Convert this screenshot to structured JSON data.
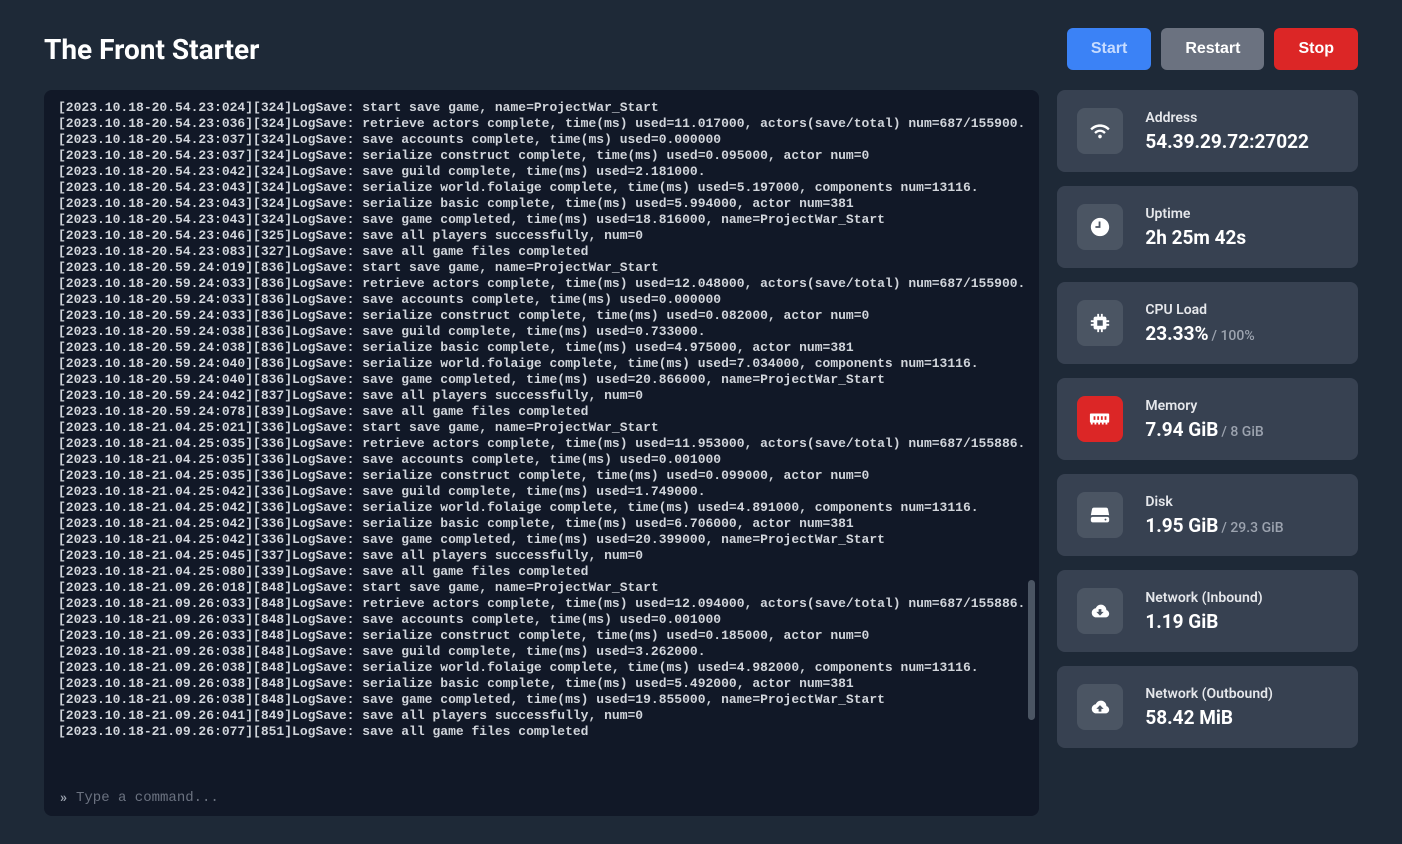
{
  "title": "The Front Starter",
  "buttons": {
    "start": "Start",
    "restart": "Restart",
    "stop": "Stop"
  },
  "command_placeholder": "Type a command...",
  "stats": {
    "address": {
      "label": "Address",
      "value": "54.39.29.72:27022"
    },
    "uptime": {
      "label": "Uptime",
      "value": "2h 25m 42s"
    },
    "cpu": {
      "label": "CPU Load",
      "value": "23.33%",
      "sub": "/ 100%"
    },
    "memory": {
      "label": "Memory",
      "value": "7.94 GiB",
      "sub": "/ 8 GiB"
    },
    "disk": {
      "label": "Disk",
      "value": "1.95 GiB",
      "sub": "/ 29.3 GiB"
    },
    "net_in": {
      "label": "Network (Inbound)",
      "value": "1.19 GiB"
    },
    "net_out": {
      "label": "Network (Outbound)",
      "value": "58.42 MiB"
    }
  },
  "log": [
    "[2023.10.18-20.54.23:024][324]LogSave: start save game, name=ProjectWar_Start",
    "[2023.10.18-20.54.23:036][324]LogSave: retrieve actors complete, time(ms) used=11.017000, actors(save/total) num=687/155900.",
    "[2023.10.18-20.54.23:037][324]LogSave: save accounts complete, time(ms) used=0.000000",
    "[2023.10.18-20.54.23:037][324]LogSave: serialize construct complete, time(ms) used=0.095000, actor num=0",
    "[2023.10.18-20.54.23:042][324]LogSave: save guild complete, time(ms) used=2.181000.",
    "[2023.10.18-20.54.23:043][324]LogSave: serialize world.folaige complete, time(ms) used=5.197000, components num=13116.",
    "[2023.10.18-20.54.23:043][324]LogSave: serialize basic complete, time(ms) used=5.994000, actor num=381",
    "[2023.10.18-20.54.23:043][324]LogSave: save game completed, time(ms) used=18.816000, name=ProjectWar_Start",
    "[2023.10.18-20.54.23:046][325]LogSave: save all players successfully, num=0",
    "[2023.10.18-20.54.23:083][327]LogSave: save all game files completed",
    "[2023.10.18-20.59.24:019][836]LogSave: start save game, name=ProjectWar_Start",
    "[2023.10.18-20.59.24:033][836]LogSave: retrieve actors complete, time(ms) used=12.048000, actors(save/total) num=687/155900.",
    "[2023.10.18-20.59.24:033][836]LogSave: save accounts complete, time(ms) used=0.000000",
    "[2023.10.18-20.59.24:033][836]LogSave: serialize construct complete, time(ms) used=0.082000, actor num=0",
    "[2023.10.18-20.59.24:038][836]LogSave: save guild complete, time(ms) used=0.733000.",
    "[2023.10.18-20.59.24:038][836]LogSave: serialize basic complete, time(ms) used=4.975000, actor num=381",
    "[2023.10.18-20.59.24:040][836]LogSave: serialize world.folaige complete, time(ms) used=7.034000, components num=13116.",
    "[2023.10.18-20.59.24:040][836]LogSave: save game completed, time(ms) used=20.866000, name=ProjectWar_Start",
    "[2023.10.18-20.59.24:042][837]LogSave: save all players successfully, num=0",
    "[2023.10.18-20.59.24:078][839]LogSave: save all game files completed",
    "[2023.10.18-21.04.25:021][336]LogSave: start save game, name=ProjectWar_Start",
    "[2023.10.18-21.04.25:035][336]LogSave: retrieve actors complete, time(ms) used=11.953000, actors(save/total) num=687/155886.",
    "[2023.10.18-21.04.25:035][336]LogSave: save accounts complete, time(ms) used=0.001000",
    "[2023.10.18-21.04.25:035][336]LogSave: serialize construct complete, time(ms) used=0.099000, actor num=0",
    "[2023.10.18-21.04.25:042][336]LogSave: save guild complete, time(ms) used=1.749000.",
    "[2023.10.18-21.04.25:042][336]LogSave: serialize world.folaige complete, time(ms) used=4.891000, components num=13116.",
    "[2023.10.18-21.04.25:042][336]LogSave: serialize basic complete, time(ms) used=6.706000, actor num=381",
    "[2023.10.18-21.04.25:042][336]LogSave: save game completed, time(ms) used=20.399000, name=ProjectWar_Start",
    "[2023.10.18-21.04.25:045][337]LogSave: save all players successfully, num=0",
    "[2023.10.18-21.04.25:080][339]LogSave: save all game files completed",
    "[2023.10.18-21.09.26:018][848]LogSave: start save game, name=ProjectWar_Start",
    "[2023.10.18-21.09.26:033][848]LogSave: retrieve actors complete, time(ms) used=12.094000, actors(save/total) num=687/155886.",
    "[2023.10.18-21.09.26:033][848]LogSave: save accounts complete, time(ms) used=0.001000",
    "[2023.10.18-21.09.26:033][848]LogSave: serialize construct complete, time(ms) used=0.185000, actor num=0",
    "[2023.10.18-21.09.26:038][848]LogSave: save guild complete, time(ms) used=3.262000.",
    "[2023.10.18-21.09.26:038][848]LogSave: serialize world.folaige complete, time(ms) used=4.982000, components num=13116.",
    "[2023.10.18-21.09.26:038][848]LogSave: serialize basic complete, time(ms) used=5.492000, actor num=381",
    "[2023.10.18-21.09.26:038][848]LogSave: save game completed, time(ms) used=19.855000, name=ProjectWar_Start",
    "[2023.10.18-21.09.26:041][849]LogSave: save all players successfully, num=0",
    "[2023.10.18-21.09.26:077][851]LogSave: save all game files completed"
  ]
}
